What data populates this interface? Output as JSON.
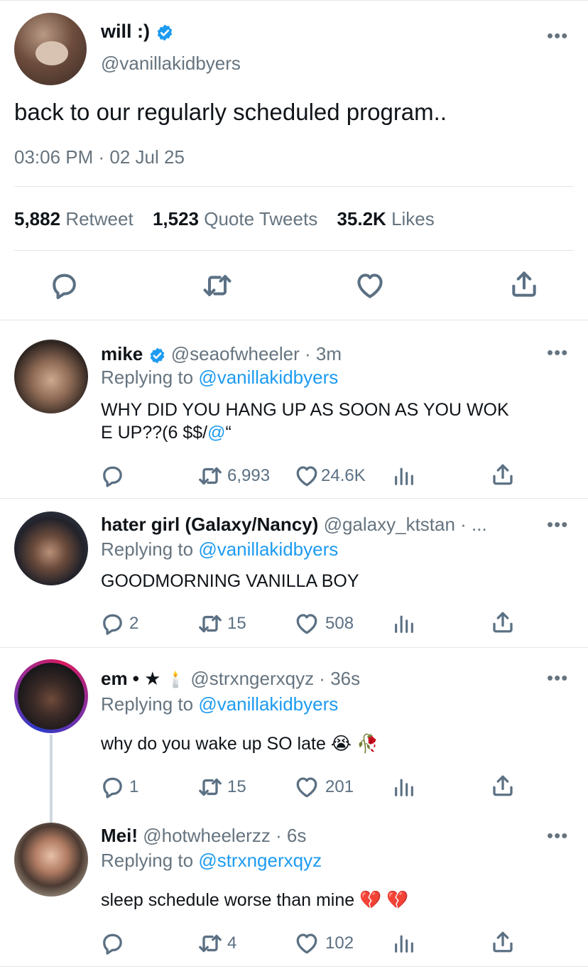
{
  "main_tweet": {
    "display_name": "will :)",
    "handle": "@vanillakidbyers",
    "text": "back to our regularly scheduled program..",
    "timestamp": "03:06 PM · 02 Jul 25",
    "stats": {
      "retweets_count": "5,882",
      "retweets_label": "Retweet",
      "quotes_count": "1,523",
      "quotes_label": "Quote Tweets",
      "likes_count": "35.2K",
      "likes_label": "Likes"
    }
  },
  "replies": [
    {
      "display_name": "mike",
      "handle_time": "@seaofwheeler · 3m",
      "replying_prefix": "Replying to ",
      "replying_to": "@vanillakidbyers",
      "text_line1": "WHY DID YOU HANG UP AS SOON AS YOU WOK",
      "text_line2_a": "E UP??(6 $$/",
      "text_line2_b": "@",
      "text_line2_c": "“",
      "replies": "",
      "retweets": "6,993",
      "likes": "24.6K"
    },
    {
      "display_name": "hater girl (Galaxy/Nancy)",
      "handle_time": "@galaxy_ktstan · ...",
      "replying_prefix": "Replying to ",
      "replying_to": "@vanillakidbyers",
      "text": "GOODMORNING VANILLA BOY",
      "replies": "2",
      "retweets": "15",
      "likes": "508"
    },
    {
      "display_name": "em • ★",
      "handle_time": "@strxngerxqyz · 36s",
      "replying_prefix": "Replying to ",
      "replying_to": "@vanillakidbyers",
      "text": "why do you wake up SO late 😭 🥀",
      "replies": "1",
      "retweets": "15",
      "likes": "201"
    },
    {
      "display_name": "Mei!",
      "handle_time": "@hotwheelerzz · 6s",
      "replying_prefix": "Replying to ",
      "replying_to": "@strxngerxqyz",
      "text": "sleep schedule worse than mine 💔 💔",
      "replies": "",
      "retweets": "4",
      "likes": "102"
    }
  ],
  "icons": {
    "reply": "reply-icon",
    "retweet": "retweet-icon",
    "like": "heart-icon",
    "analytics": "analytics-icon",
    "share": "share-icon",
    "more": "more-icon",
    "verified": "verified-badge-icon"
  },
  "colors": {
    "accent": "#1d9bf0",
    "secondary_text": "#66747f",
    "divider": "#e3e7ea"
  }
}
